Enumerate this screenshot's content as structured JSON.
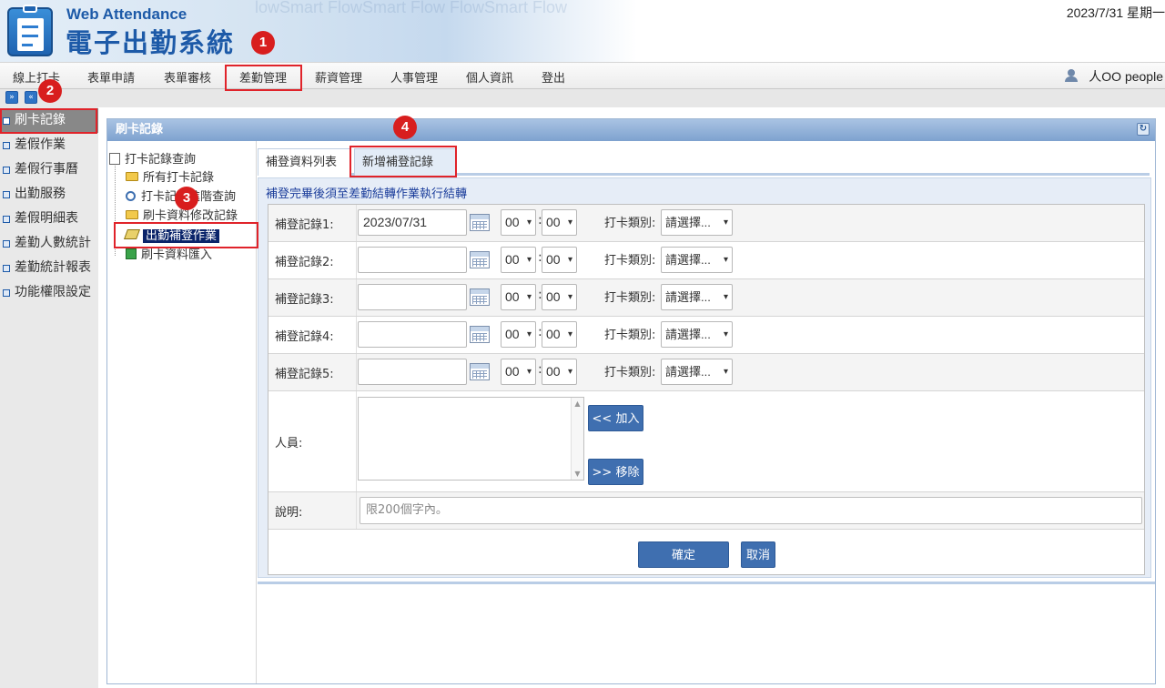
{
  "header": {
    "title_en": "Web Attendance",
    "title_zh": "電子出勤系統",
    "banner_deco": "lowSmart FlowSmart Flow FlowSmart Flow",
    "date": "2023/7/31 星期一"
  },
  "menu": {
    "items": [
      "線上打卡",
      "表單申請",
      "表單審核",
      "差勤管理",
      "薪資管理",
      "人事管理",
      "個人資訊",
      "登出"
    ],
    "user": "人OO people"
  },
  "toolbar": {
    "btn1": "»",
    "btn2": "«"
  },
  "sidebar": {
    "items": [
      "刷卡記錄",
      "差假作業",
      "差假行事曆",
      "出勤服務",
      "差假明細表",
      "差勤人數統計",
      "差勤統計報表",
      "功能權限設定"
    ]
  },
  "panel": {
    "title": "刷卡記錄",
    "refresh": "↻"
  },
  "tree": {
    "root": "打卡記錄查詢",
    "items": [
      "所有打卡記錄",
      "打卡記錄進階查詢",
      "刷卡資料修改記錄",
      "出勤補登作業",
      "刷卡資料匯入"
    ]
  },
  "tabs": [
    "補登資料列表",
    "新增補登記錄"
  ],
  "form": {
    "note": "補登完畢後須至差勤結轉作業執行結轉",
    "records": [
      {
        "label": "補登記錄1:",
        "date": "2023/07/31",
        "hour": "00",
        "minute": "00",
        "type_label": "打卡類別:",
        "type": "請選擇..."
      },
      {
        "label": "補登記錄2:",
        "date": "",
        "hour": "00",
        "minute": "00",
        "type_label": "打卡類別:",
        "type": "請選擇..."
      },
      {
        "label": "補登記錄3:",
        "date": "",
        "hour": "00",
        "minute": "00",
        "type_label": "打卡類別:",
        "type": "請選擇..."
      },
      {
        "label": "補登記錄4:",
        "date": "",
        "hour": "00",
        "minute": "00",
        "type_label": "打卡類別:",
        "type": "請選擇..."
      },
      {
        "label": "補登記錄5:",
        "date": "",
        "hour": "00",
        "minute": "00",
        "type_label": "打卡類別:",
        "type": "請選擇..."
      }
    ],
    "people_label": "人員:",
    "add_button": "<< 加入",
    "remove_button": ">> 移除",
    "desc_label": "說明:",
    "desc_placeholder": "限200個字內。",
    "ok_button": "確定",
    "cancel_button": "取消"
  },
  "markers": [
    "1",
    "2",
    "3",
    "4"
  ],
  "colors": {
    "accent": "#1d5aa8",
    "button": "#3f6fb0",
    "highlight": "#e0232a",
    "marker": "#d81e1e"
  }
}
